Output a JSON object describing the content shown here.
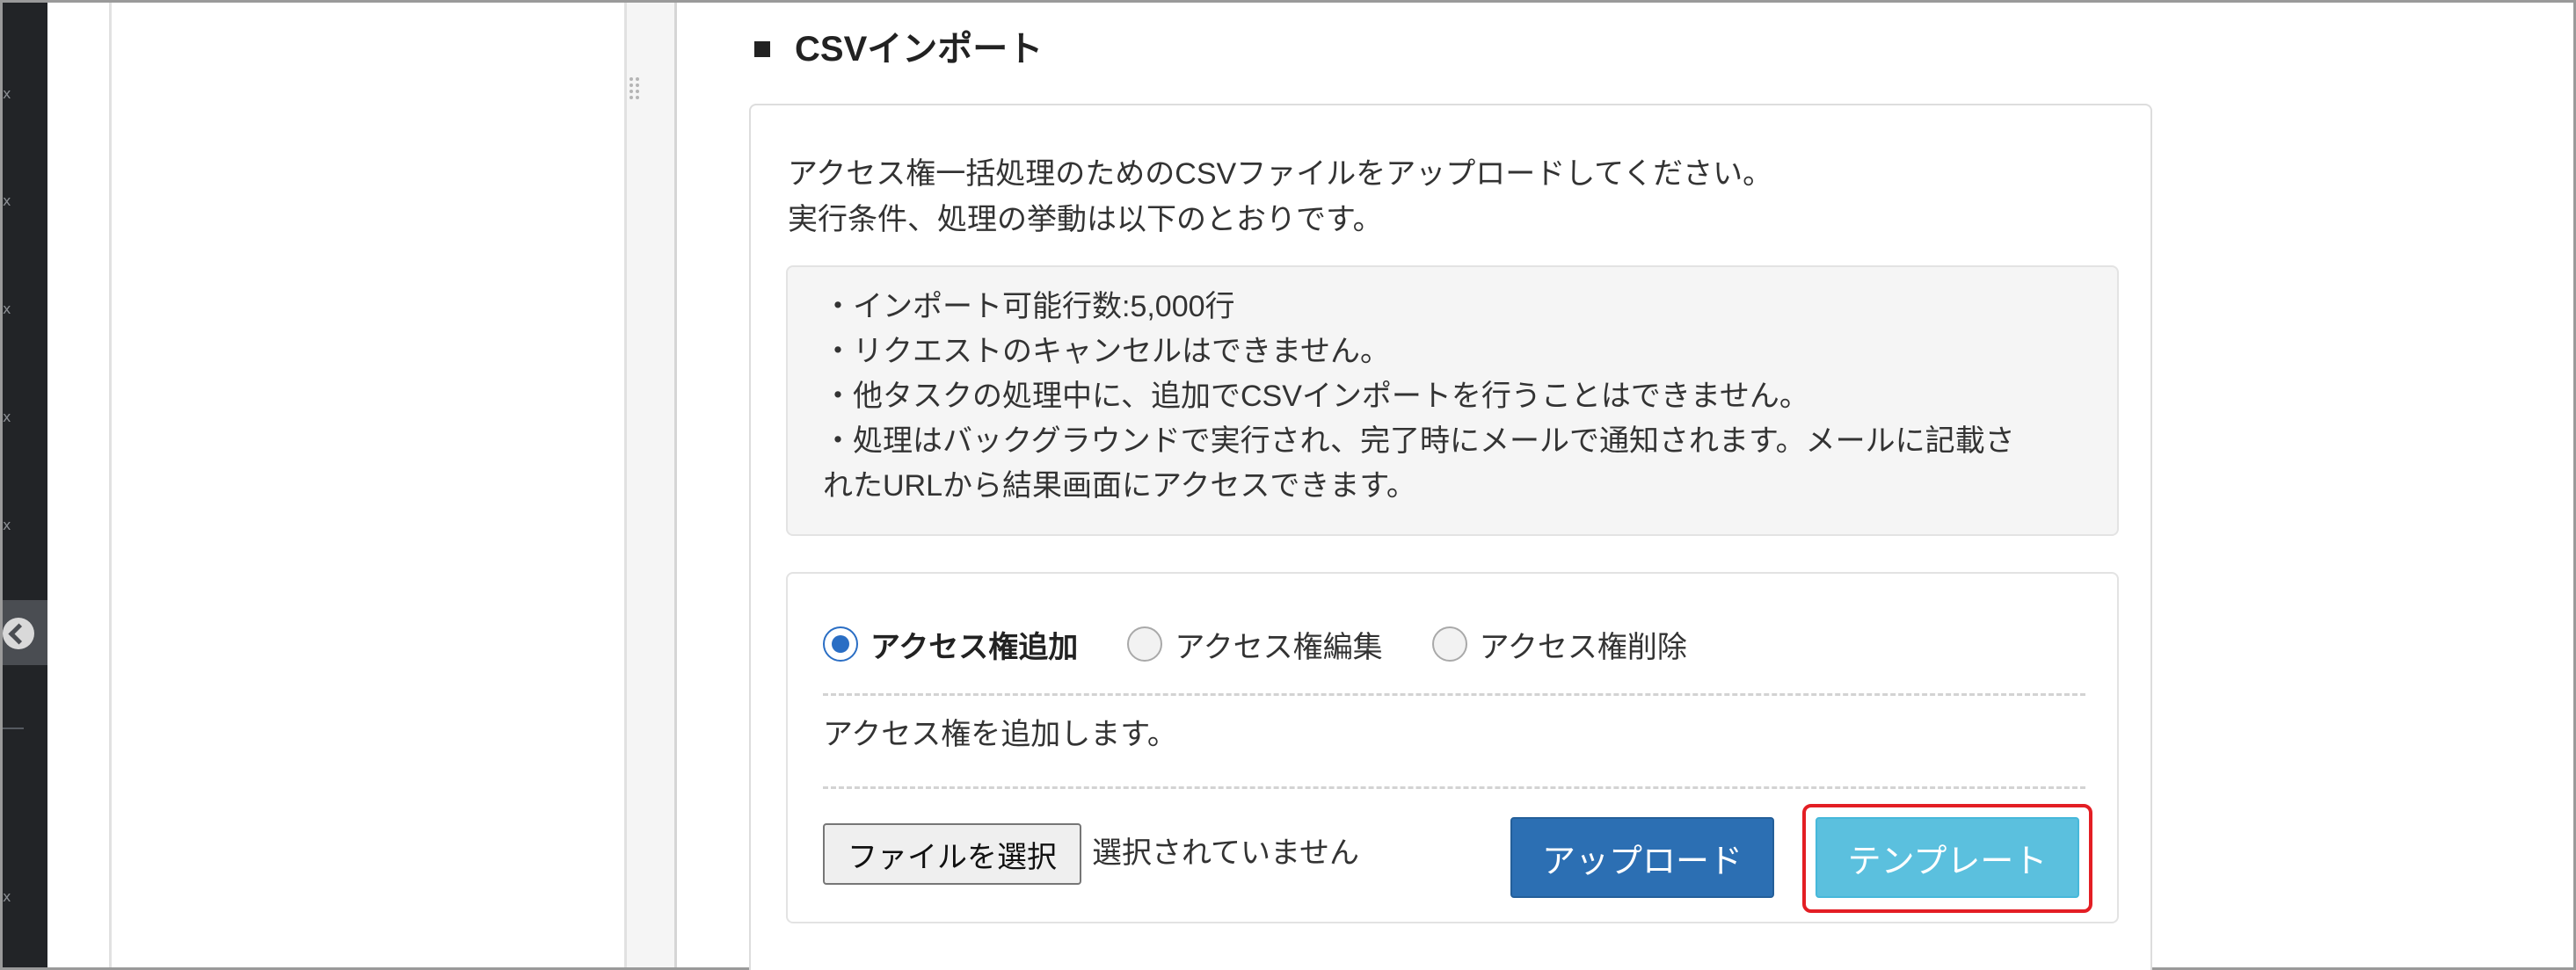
{
  "nav": {
    "marks": [
      "x",
      "x",
      "x",
      "x",
      "x",
      "x"
    ],
    "collapse_icon": "arrow-left-circle-icon"
  },
  "section": {
    "title": "CSVインポート"
  },
  "intro": {
    "line1": "アクセス権一括処理のためのCSVファイルをアップロードしてください。",
    "line2": "実行条件、処理の挙動は以下のとおりです。"
  },
  "notes": [
    "・インポート可能行数:5,000行",
    "・リクエストのキャンセルはできません。",
    "・他タスクの処理中に、追加でCSVインポートを行うことはできません。",
    "・処理はバックグラウンドで実行され、完了時にメールで通知されます。メールに記載さ",
    "れたURLから結果画面にアクセスできます。"
  ],
  "operations": {
    "options": [
      {
        "label": "アクセス権追加",
        "selected": true
      },
      {
        "label": "アクセス権編集",
        "selected": false
      },
      {
        "label": "アクセス権削除",
        "selected": false
      }
    ],
    "description": "アクセス権を追加します。"
  },
  "file": {
    "button_label": "ファイルを選択",
    "status": "選択されていません"
  },
  "actions": {
    "upload_label": "アップロード",
    "template_label": "テンプレート",
    "highlight_color": "#e31e24",
    "upload_color": "#2c6fb3",
    "template_color": "#5bc0de",
    "radio_color": "#2a6ec4"
  }
}
